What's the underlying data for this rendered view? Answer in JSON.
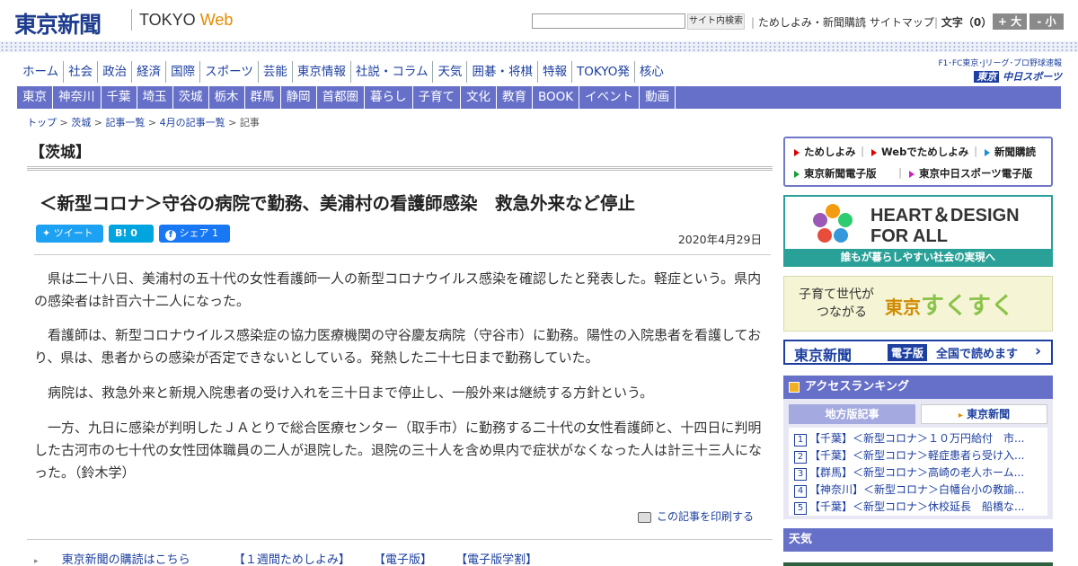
{
  "header": {
    "logo": "東京新聞",
    "logo_tokyo": "TOKYO",
    "logo_web": "Web",
    "search_button": "サイト内検索",
    "search_placeholder": "",
    "util_links": [
      "ためしよみ・新聞購読",
      "サイトマップ"
    ],
    "font_size_label": "文字（0）",
    "font_bigger": "+ 大",
    "font_smaller": "- 小"
  },
  "main_nav": [
    "ホーム",
    "社会",
    "政治",
    "経済",
    "国際",
    "スポーツ",
    "芸能",
    "東京情報",
    "社説・コラム",
    "天気",
    "囲碁・将棋",
    "特報",
    "TOKYO発",
    "核心"
  ],
  "chunichi_sports": {
    "small": "F1･FC東京･Jリーグ･プロ野球速報",
    "brand_prefix": "東京",
    "brand": "中日スポーツ"
  },
  "sub_nav": [
    "東京",
    "神奈川",
    "千葉",
    "埼玉",
    "茨城",
    "栃木",
    "群馬",
    "静岡",
    "首都圏",
    "暮らし",
    "子育て",
    "文化",
    "教育",
    "BOOK",
    "イベント",
    "動画"
  ],
  "breadcrumb": [
    "トップ",
    "茨城",
    "記事一覧",
    "4月の記事一覧",
    "記事"
  ],
  "article": {
    "section": "【茨城】",
    "headline": "＜新型コロナ＞守谷の病院で勤務、美浦村の看護師感染　救急外来など停止",
    "tweet_label": "ツイート",
    "hatena_label": "B! 0",
    "share_label": "シェア 1",
    "date": "2020年4月29日",
    "paragraphs": [
      "県は二十八日、美浦村の五十代の女性看護師一人の新型コロナウイルス感染を確認したと発表した。軽症という。県内の感染者は計百六十二人になった。",
      "看護師は、新型コロナウイルス感染症の協力医療機関の守谷慶友病院（守谷市）に勤務。陽性の入院患者を看護しており、県は、患者からの感染が否定できないとしている。発熱した二十七日まで勤務していた。",
      "病院は、救急外来と新規入院患者の受け入れを三十日まで停止し、一般外来は継続する方針という。",
      "一方、九日に感染が判明したＪＡとりで総合医療センター（取手市）に勤務する二十代の女性看護師と、十四日に判明した古河市の七十代の女性団体職員の二人が退院した。退院の三十人を含め県内で症状がなくなった人は計三十三人になった。（鈴木学）"
    ],
    "print_label": "この記事を印刷する"
  },
  "bottom_links": [
    "東京新聞の購読はこちら",
    "【１週間ためしよみ】",
    "【電子版】",
    "【電子版学割】"
  ],
  "sidebar": {
    "promo_links": [
      "ためしよみ",
      "Webでためしよみ",
      "新聞購読",
      "東京新聞電子版",
      "東京中日スポーツ電子版"
    ],
    "hd_line1": "HEART＆DESIGN",
    "hd_line2": "FOR ALL",
    "hd_caption": "誰もが暮らしやすい社会の実現へ",
    "sukusuku_line1": "子育て世代が",
    "sukusuku_line2": "つながる",
    "sukusuku_brand_a": "東京",
    "sukusuku_brand_b": "すくすく",
    "eban_name": "東京新聞",
    "eban_badge": "電子版",
    "eban_text": "全国で読めます",
    "ranking_title": "アクセスランキング",
    "ranking_tabs": [
      "地方版記事",
      "東京新聞"
    ],
    "ranking_items": [
      {
        "num": "1",
        "text": "【千葉】＜新型コロナ＞１０万円給付　市..."
      },
      {
        "num": "2",
        "text": "【千葉】＜新型コロナ＞軽症患者ら受け入..."
      },
      {
        "num": "3",
        "text": "【群馬】＜新型コロナ＞高崎の老人ホーム..."
      },
      {
        "num": "4",
        "text": "【神奈川】＜新型コロナ＞白幡台小の教諭..."
      },
      {
        "num": "5",
        "text": "【千葉】＜新型コロナ＞休校延長　船橋な..."
      }
    ],
    "weather_title": "天気"
  },
  "colors": {
    "nav_blue": "#6670c8",
    "link_blue": "#1c3fa0",
    "accent_orange": "#e58b00",
    "hd_teal": "#2aa198"
  }
}
